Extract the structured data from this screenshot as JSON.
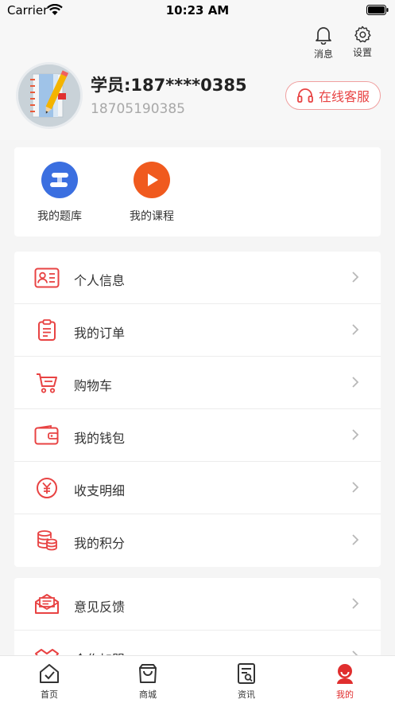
{
  "status_bar": {
    "carrier": "Carrier",
    "time": "10:23 AM"
  },
  "header": {
    "messages_label": "消息",
    "settings_label": "设置"
  },
  "profile": {
    "name": "学员:187****0385",
    "phone": "18705190385",
    "service_label": "在线客服"
  },
  "quick": [
    {
      "label": "我的题库",
      "icon": "question-bank-icon",
      "color": "#3b6fe0"
    },
    {
      "label": "我的课程",
      "icon": "play-course-icon",
      "color": "#f05a1e"
    }
  ],
  "menu": [
    {
      "label": "个人信息",
      "icon": "id-card-icon"
    },
    {
      "label": "我的订单",
      "icon": "order-clipboard-icon"
    },
    {
      "label": "购物车",
      "icon": "shopping-cart-icon"
    },
    {
      "label": "我的钱包",
      "icon": "wallet-icon"
    },
    {
      "label": "收支明细",
      "icon": "yen-coin-icon"
    },
    {
      "label": "我的积分",
      "icon": "coin-stack-icon"
    }
  ],
  "menu2": [
    {
      "label": "意见反馈",
      "icon": "feedback-mail-icon"
    },
    {
      "label": "合作加盟",
      "icon": "handshake-icon"
    }
  ],
  "tabs": [
    {
      "label": "首页",
      "icon": "home-icon"
    },
    {
      "label": "商城",
      "icon": "shopping-bag-icon"
    },
    {
      "label": "资讯",
      "icon": "news-icon"
    },
    {
      "label": "我的",
      "icon": "profile-icon"
    }
  ],
  "colors": {
    "accent": "#e84343",
    "background": "#f5f5f5"
  }
}
